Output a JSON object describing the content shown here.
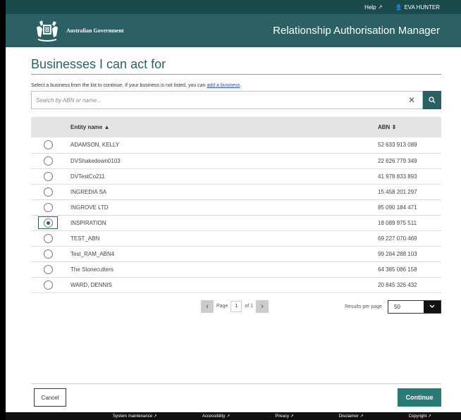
{
  "topbar": {
    "help_label": "Help",
    "user_name": "EVA HUNTER"
  },
  "header": {
    "brand": "Australian Government",
    "app_title": "Relationship Authorisation Manager"
  },
  "page": {
    "title": "Businesses I can act for",
    "intro_text": "Select a business from the list to continue. If your business is not listed, you can ",
    "intro_link": "add a business",
    "intro_end": "."
  },
  "search": {
    "placeholder": "Search by ABN or name..."
  },
  "table": {
    "col_name": "Entity name",
    "col_abn": "ABN",
    "rows": [
      {
        "name": "ADAMSON, KELLY",
        "abn": "52 633 913 089"
      },
      {
        "name": "DVShakedown0103",
        "abn": "22 626 779 349"
      },
      {
        "name": "DVTestCo211",
        "abn": "41 978 833 893"
      },
      {
        "name": "INGREDIA SA",
        "abn": "15 458 201 297"
      },
      {
        "name": "INGROVE LTD",
        "abn": "85 090 184 471"
      },
      {
        "name": "INSPIRATION",
        "abn": "18 089 975 511"
      },
      {
        "name": "TEST_ABN",
        "abn": "69 227 070 469"
      },
      {
        "name": "Test_RAM_ABN4",
        "abn": "99 284 288 103"
      },
      {
        "name": "The Stonecutters",
        "abn": "64 385 086 158"
      },
      {
        "name": "WARD, DENNIS",
        "abn": "20 845 326 432"
      }
    ],
    "selected_index": 5
  },
  "pager": {
    "page_label": "Page",
    "current": "1",
    "of_label": "of",
    "total": "1",
    "rpp_label": "Results per page",
    "rpp_value": "50"
  },
  "actions": {
    "cancel": "Cancel",
    "continue": "Continue"
  },
  "footer": {
    "links": [
      "System maintenance",
      "Accessibility",
      "Privacy",
      "Disclaimer",
      "Copyright"
    ]
  },
  "colors": {
    "brand_teal": "#2b6064",
    "topbar": "#1b4a4c",
    "continue": "#2b7a78"
  }
}
